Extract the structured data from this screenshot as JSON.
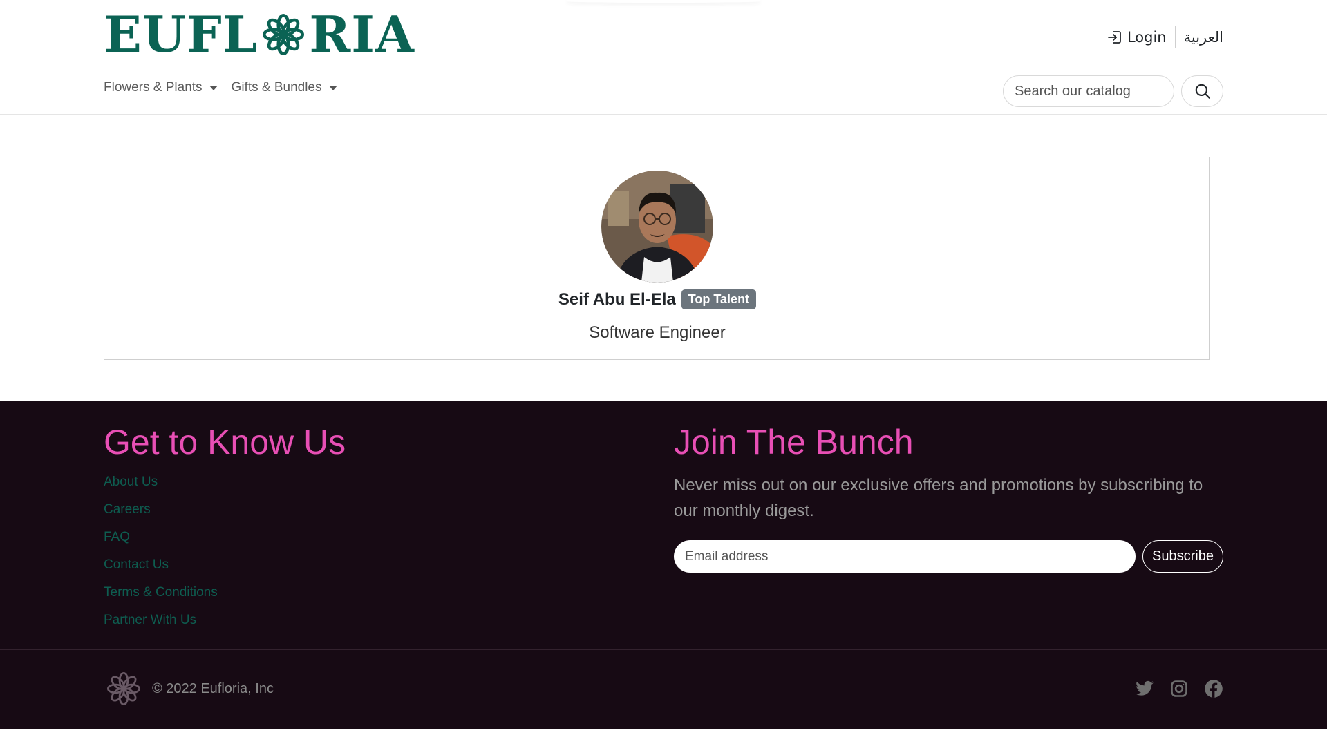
{
  "header": {
    "logo_left": "EUFL",
    "logo_right": "RIA",
    "login_label": "Login",
    "language_label": "العربية",
    "nav": [
      {
        "label": "Flowers & Plants"
      },
      {
        "label": "Gifts & Bundles"
      }
    ],
    "search": {
      "placeholder": "Search our catalog",
      "value": ""
    }
  },
  "profile": {
    "name": "Seif Abu El-Ela",
    "badge": "Top Talent",
    "role": "Software Engineer"
  },
  "footer": {
    "left_heading": "Get to Know Us",
    "links": [
      {
        "label": "About Us"
      },
      {
        "label": "Careers"
      },
      {
        "label": "FAQ"
      },
      {
        "label": "Contact Us"
      },
      {
        "label": "Terms & Conditions"
      },
      {
        "label": "Partner With Us"
      }
    ],
    "right_heading": "Join The Bunch",
    "newsletter_text": "Never miss out on our exclusive offers and promotions by subscribing to our monthly digest.",
    "email": {
      "placeholder": "Email address",
      "value": ""
    },
    "subscribe_label": "Subscribe",
    "copyright": "© 2022 Eufloria, Inc",
    "socials": [
      "twitter-icon",
      "instagram-icon",
      "facebook-icon"
    ]
  },
  "colors": {
    "brand_green": "#0b6354",
    "footer_bg": "#170a14",
    "footer_heading_pink": "#e84fb5",
    "badge_gray": "#6c757d"
  }
}
